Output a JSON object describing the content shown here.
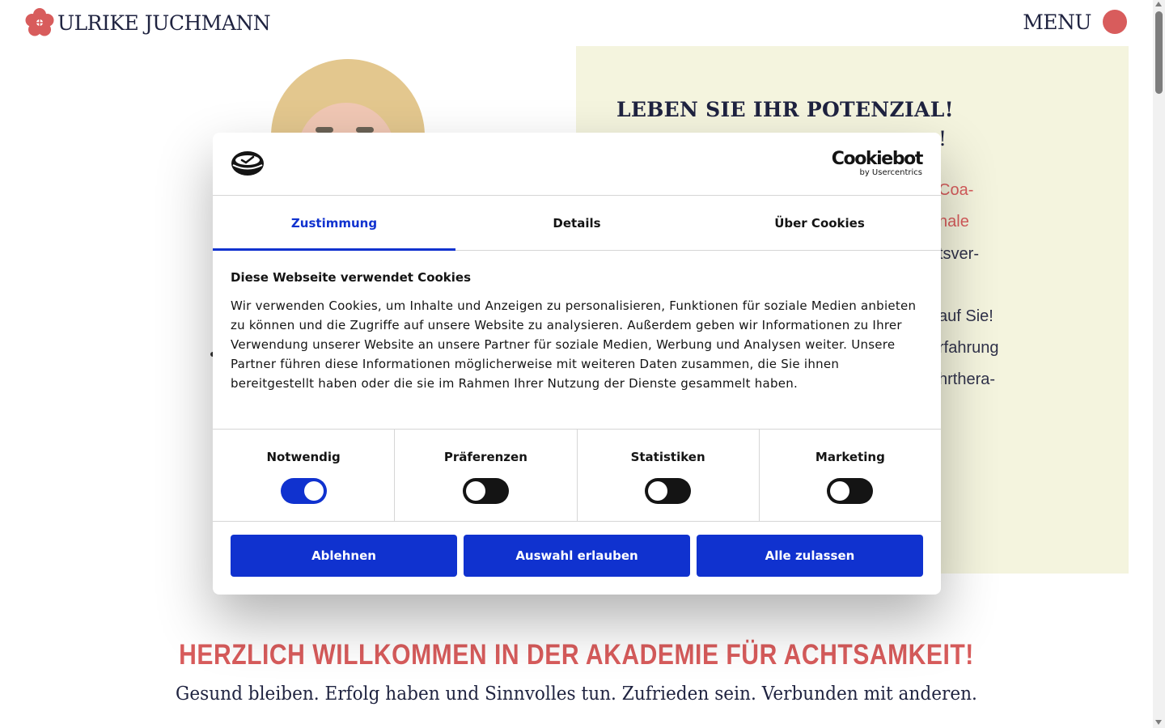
{
  "colors": {
    "accent": "#d85c5c",
    "navy": "#1f2340",
    "panel_bg": "#f4f4de",
    "cookie_blue": "#1032cf"
  },
  "header": {
    "logo_icon": "flower-icon",
    "brand_name": "ULRIKE JUCHMANN",
    "menu_label": "MENU"
  },
  "hero": {
    "title": "LEBEN SIE IHR POTENZIAL!",
    "subtitle_fragment": "!",
    "lines": [
      {
        "text": "Coa-",
        "accent": true
      },
      {
        "text": "nale",
        "accent": true
      },
      {
        "text": "tsver-",
        "accent": false
      },
      {
        "text": "auf Sie!",
        "accent": false
      },
      {
        "text": "rfahrung",
        "accent": false
      },
      {
        "text": "hrthera-",
        "accent": false
      }
    ]
  },
  "welcome": {
    "heading": "HERZLICH WILLKOMMEN IN DER AKADEMIE FÜR ACHTSAMKEIT!",
    "subheading": "Gesund bleiben. Erfolg haben und Sinnvolles tun. Zufrieden sein. Verbunden mit anderen."
  },
  "cookie_dialog": {
    "brand_icon": "cookiebot-icon",
    "cookiebot_word": "Cookiebot",
    "cookiebot_by": "by Usercentrics",
    "tabs": [
      {
        "label": "Zustimmung",
        "active": true
      },
      {
        "label": "Details",
        "active": false
      },
      {
        "label": "Über Cookies",
        "active": false
      }
    ],
    "title": "Diese Webseite verwendet Cookies",
    "text": "Wir verwenden Cookies, um Inhalte und Anzeigen zu personalisieren, Funktionen für soziale Medien anbieten zu können und die Zugriffe auf unsere Website zu analysieren. Außerdem geben wir Informationen zu Ihrer Verwendung unserer Website an unsere Partner für soziale Medien, Werbung und Analysen weiter. Unsere Partner führen diese Informationen möglicherweise mit weiteren Daten zusammen, die Sie ihnen bereitgestellt haben oder die sie im Rahmen Ihrer Nutzung der Dienste gesammelt haben.",
    "toggles": [
      {
        "label": "Notwendig",
        "on": true
      },
      {
        "label": "Präferenzen",
        "on": false
      },
      {
        "label": "Statistiken",
        "on": false
      },
      {
        "label": "Marketing",
        "on": false
      }
    ],
    "buttons": {
      "decline": "Ablehnen",
      "allow_selection": "Auswahl erlauben",
      "allow_all": "Alle zulassen"
    }
  }
}
